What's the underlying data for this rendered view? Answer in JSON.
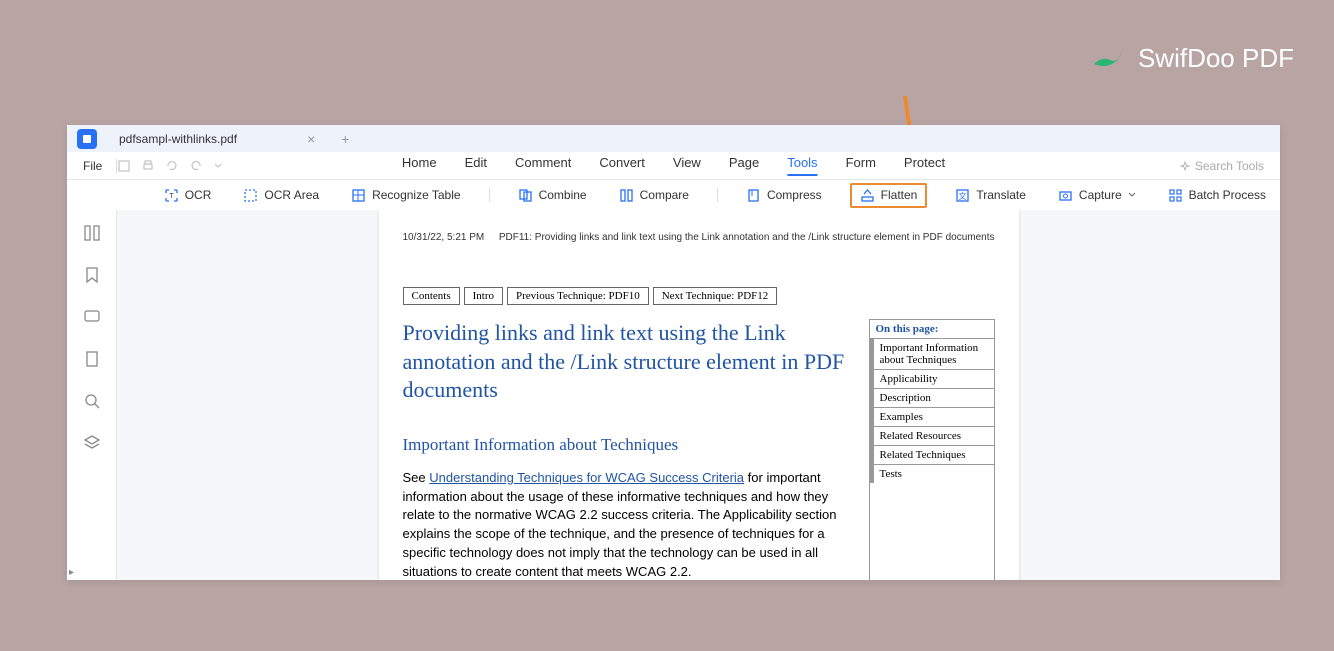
{
  "brand": {
    "name": "SwifDoo PDF"
  },
  "tab": {
    "title": "pdfsampl-withlinks.pdf"
  },
  "menu": {
    "file": "File"
  },
  "main_menus": [
    "Home",
    "Edit",
    "Comment",
    "Convert",
    "View",
    "Page",
    "Tools",
    "Form",
    "Protect"
  ],
  "active_menu_index": 6,
  "search": {
    "placeholder": "Search Tools"
  },
  "toolbar": {
    "ocr": "OCR",
    "ocr_area": "OCR Area",
    "recognize_table": "Recognize Table",
    "combine": "Combine",
    "compare": "Compare",
    "compress": "Compress",
    "flatten": "Flatten",
    "translate": "Translate",
    "capture": "Capture",
    "batch": "Batch Process"
  },
  "doc": {
    "timestamp": "10/31/22, 5:21 PM",
    "header": "PDF11: Providing links and link text using the Link annotation and the /Link structure element in PDF documents",
    "navs": [
      "Contents",
      "Intro",
      "Previous Technique: PDF10",
      "Next Technique: PDF12"
    ],
    "title": "Providing links and link text using the Link annotation and the /Link structure element in PDF documents",
    "toc_header": "On this page:",
    "toc": [
      "Important Information about Techniques",
      "Applicability",
      "Description",
      "Examples",
      "Related Resources",
      "Related Techniques",
      "Tests"
    ],
    "section_h": "Important Information about Techniques",
    "p_pre": "See ",
    "p_link": "Understanding Techniques for WCAG Success Criteria",
    "p_post": " for important information about the usage of these informative techniques and how they relate to the normative WCAG 2.2 success criteria. The Applicability section explains the scope of the technique, and the presence of techniques for a specific technology does not imply that the technology can be used in all situations to create content that meets WCAG 2.2."
  }
}
